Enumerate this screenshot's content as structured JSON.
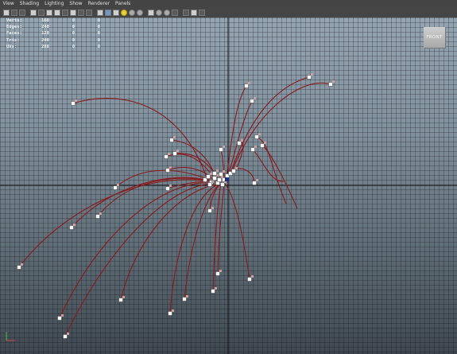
{
  "menu": [
    "View",
    "Shading",
    "Lighting",
    "Show",
    "Renderer",
    "Panels"
  ],
  "heads_up_display": {
    "rows": [
      {
        "label": "Verts:",
        "values": [
          "168",
          "0",
          "0"
        ]
      },
      {
        "label": "Edges:",
        "values": [
          "240",
          "0",
          "0"
        ]
      },
      {
        "label": "Faces:",
        "values": [
          "120",
          "0",
          "0"
        ]
      },
      {
        "label": "Tris:",
        "values": [
          "240",
          "0",
          "0"
        ]
      },
      {
        "label": "UVs:",
        "values": [
          "288",
          "0",
          "0"
        ]
      }
    ]
  },
  "view_cube_label": "FRONT",
  "toolbar_icons": [
    "camera-icon",
    "camera-attributes-icon",
    "bookmark-icon",
    "image-plane-icon",
    "grid-icon",
    "film-gate-icon",
    "resolution-gate-icon",
    "gate-mask-icon",
    "field-chart-icon",
    "safe-action-icon",
    "safe-title-icon",
    "wireframe-icon",
    "smooth-shade-icon",
    "textured-icon",
    "default-lighting-icon",
    "shadows-icon",
    "ambient-occlusion-icon",
    "isolate-select-icon",
    "xray-icon",
    "xray-joints-icon",
    "xray-components-icon",
    "high-quality-icon",
    "camera-pan-icon",
    "resize-icon"
  ],
  "colors": {
    "curve": "#8a1a1a",
    "locator": "#ffffff"
  }
}
